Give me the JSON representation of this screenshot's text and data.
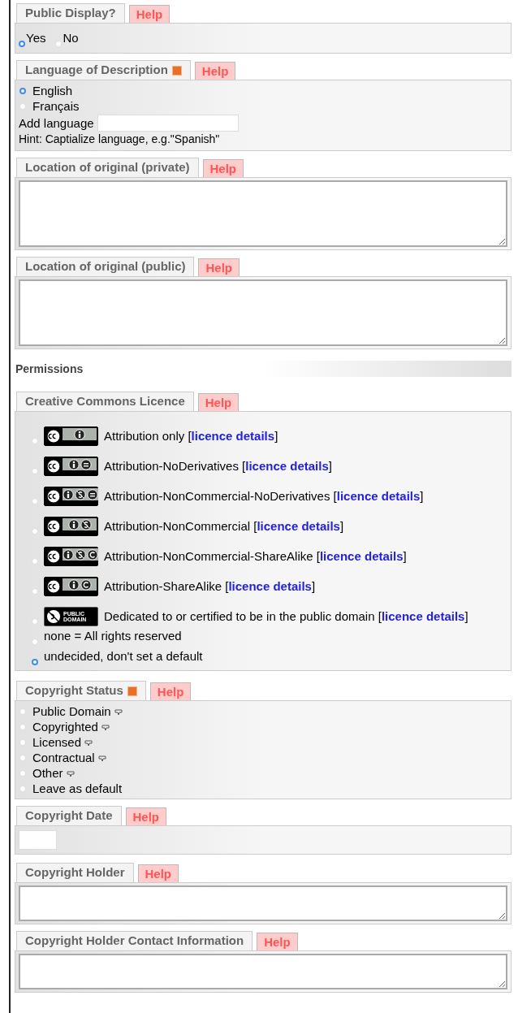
{
  "sections": [
    {
      "kind": "radio_inline",
      "title": "Public Display?",
      "help": "Help",
      "options": [
        {
          "label": "Yes",
          "selected": true
        },
        {
          "label": "No",
          "selected": false
        }
      ]
    },
    {
      "kind": "language",
      "title": "Language of Description",
      "required": true,
      "help": "Help",
      "options": [
        {
          "label": "English",
          "selected": true
        },
        {
          "label": "Français",
          "selected": false
        }
      ],
      "add_label": "Add language",
      "hint": "Hint: Captialize language, e.g.\"Spanish\""
    },
    {
      "kind": "textarea",
      "title": "Location of original (private)",
      "help": "Help"
    },
    {
      "kind": "textarea",
      "title": "Location of original (public)",
      "help": "Help"
    },
    {
      "kind": "heading",
      "title": "Permissions"
    },
    {
      "kind": "licence",
      "title": "Creative Commons Licence",
      "help": "Help",
      "options": [
        {
          "kind": "cc",
          "marks": [
            {
              "kind": "by"
            }
          ],
          "label": "Attribution only [",
          "link": "licence details",
          "suffix": "]",
          "selected": false
        },
        {
          "kind": "cc",
          "marks": [
            {
              "kind": "by"
            },
            {
              "kind": "nd"
            }
          ],
          "label": "Attribution-NoDerivatives [",
          "link": "licence details",
          "suffix": "]",
          "selected": false
        },
        {
          "kind": "cc",
          "marks": [
            {
              "kind": "by"
            },
            {
              "kind": "nc"
            },
            {
              "kind": "nd"
            }
          ],
          "label": "Attribution-NonCommercial-NoDerivatives [",
          "link": "licence details",
          "suffix": "]",
          "selected": false
        },
        {
          "kind": "cc",
          "marks": [
            {
              "kind": "by"
            },
            {
              "kind": "nc"
            }
          ],
          "label": "Attribution-NonCommercial [",
          "link": "licence details",
          "suffix": "]",
          "selected": false
        },
        {
          "kind": "cc",
          "marks": [
            {
              "kind": "by"
            },
            {
              "kind": "nc"
            },
            {
              "kind": "sa"
            }
          ],
          "label": "Attribution-NonCommercial-ShareAlike [",
          "link": "licence details",
          "suffix": "]",
          "selected": false
        },
        {
          "kind": "cc",
          "marks": [
            {
              "kind": "by"
            },
            {
              "kind": "sa"
            }
          ],
          "label": "Attribution-ShareAlike [",
          "link": "licence details",
          "suffix": "]",
          "selected": false
        },
        {
          "kind": "pd",
          "badge_text": "PUBLIC DOMAIN",
          "label": "Dedicated to or certified to be in the public domain [",
          "link": "licence details",
          "suffix": "]",
          "selected": false
        },
        {
          "kind": "plain",
          "label": "none = All rights reserved",
          "selected": false
        },
        {
          "kind": "plain",
          "label": "undecided, don't set a default",
          "selected": true
        }
      ]
    },
    {
      "kind": "radio_list",
      "title": "Copyright Status",
      "required": true,
      "help": "Help",
      "options": [
        {
          "label": "Public Domain",
          "comment": true,
          "selected": false
        },
        {
          "label": "Copyrighted",
          "comment": true,
          "selected": false
        },
        {
          "label": "Licensed",
          "comment": true,
          "selected": false
        },
        {
          "label": "Contractual",
          "comment": true,
          "selected": false
        },
        {
          "label": "Other",
          "comment": true,
          "selected": false
        },
        {
          "label": "Leave as default",
          "comment": false,
          "selected": false
        }
      ]
    },
    {
      "kind": "text_input",
      "title": "Copyright Date",
      "help": "Help"
    },
    {
      "kind": "short_textarea",
      "title": "Copyright Holder",
      "help": "Help"
    },
    {
      "kind": "short_textarea",
      "title": "Copyright Holder Contact Information",
      "help": "Help"
    }
  ]
}
